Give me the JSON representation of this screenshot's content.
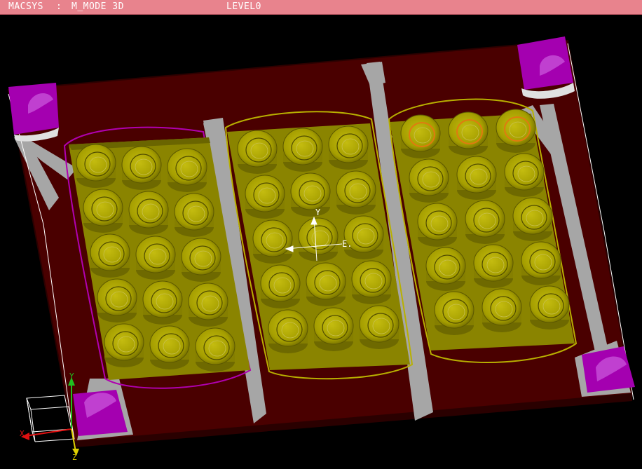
{
  "titlebar": {
    "app": "MACSYS",
    "separator": ":",
    "mode": "M_MODE 3D",
    "level": "LEVEL0"
  },
  "view_axes": {
    "y": "Y",
    "e": "E."
  },
  "triad_axes": {
    "x": "X",
    "y": "Y",
    "z": "Z"
  },
  "colors": {
    "background": "#000000",
    "titlebar": "#e8838d",
    "plate": "#4a0000",
    "plate_edge": "#2a0000",
    "cavity": "#a9a200",
    "cavity_shade": "#6e6900",
    "clamp": "#a400b0",
    "gray": "#a6a6a6"
  },
  "mold": {
    "cavity_blocks": 3,
    "cells_per_block": 15,
    "corner_clamps": 4
  }
}
